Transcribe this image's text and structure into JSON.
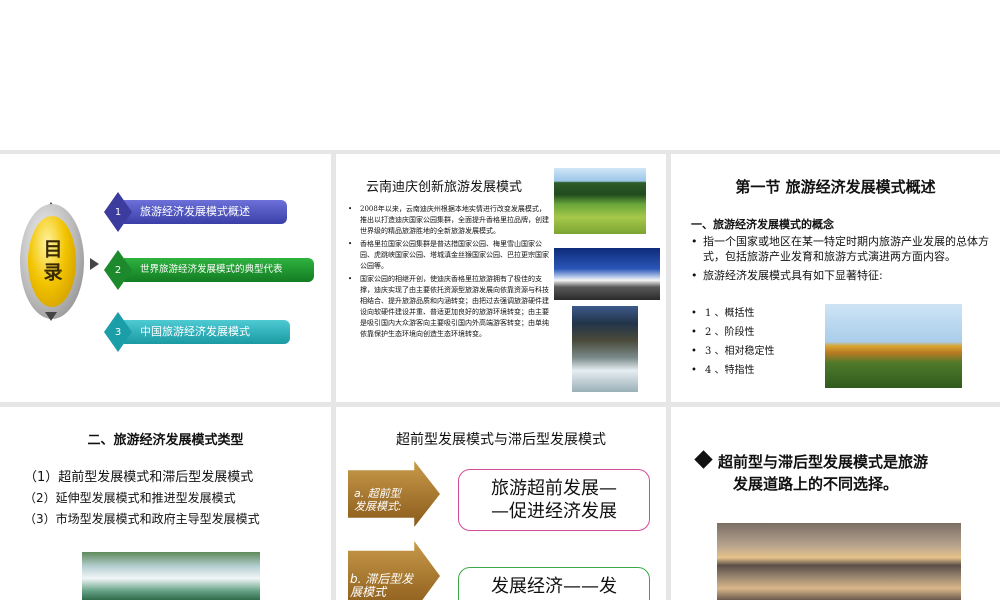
{
  "slide1": {
    "toc_title": "目录",
    "items": [
      {
        "num": "1",
        "label": "旅游经济发展模式概述"
      },
      {
        "num": "2",
        "label": "世界旅游经济发展模式的典型代表"
      },
      {
        "num": "3",
        "label": "中国旅游经济发展模式"
      }
    ]
  },
  "slide2": {
    "title": "云南迪庆创新旅游发展模式",
    "bullets": [
      "2008年以来，云南迪庆州根据本地实情进行改变发展模式，推出以打造迪庆国家公园集群，全面提升香格里拉品牌，创建世界级的精品旅游胜地的全新旅游发展模式。",
      "香格里拉国家公园集群是普达措国家公园、梅里雪山国家公园、虎跳峡国家公园、塔城滇金丝猴国家公园、巴拉更宗国家公园等。",
      "国家公园的相继开创，使迪庆香格里拉旅游拥有了极佳的支撑，迪庆实现了由主要依托资源型旅游发展向依靠资源与科技相结合、提升旅游品质和内涵转变；由把过去强调旅游硬件建设向软硬件建设并重、普适更加良好的旅游环境转变；由主要是吸引国内大众游客向主要吸引国内外高端游客转变；由单纯依靠保护生态环境向创造生态环境转变。"
    ]
  },
  "slide3": {
    "title": "第一节  旅游经济发展模式概述",
    "subtitle": "一、旅游经济发展模式的概念",
    "para1": "指一个国家或地区在某一特定时期内旅游产业发展的总体方式，包括旅游产业发育和旅游方式演进两方面内容。",
    "para2": "旅游经济发展模式具有如下显著特征:",
    "features": [
      "1 、概括性",
      "2 、阶段性",
      "3 、相对稳定性",
      "4 、特指性"
    ]
  },
  "slide4": {
    "title": "二、旅游经济发展模式类型",
    "items": [
      "（1）超前型发展模式和滞后型发展模式",
      "（2）延伸型发展模式和推进型发展模式",
      "（3）市场型发展模式和政府主导型发展模式"
    ]
  },
  "slide5": {
    "title": "超前型发展模式与滞后型发展模式",
    "arrow_a_line1": "a. 超前型",
    "arrow_a_line2": "发展模式:",
    "arrow_b_line1": "b. 滞后型发",
    "arrow_b_line2": "展模式",
    "box_a_line1": "旅游超前发展—",
    "box_a_line2": "—促进经济发展",
    "box_b_line1": "发展经济——发"
  },
  "slide6": {
    "line1": "超前型与滞后型发展模式是旅游",
    "line2": "发展道路上的不同选择。"
  },
  "colors": {
    "band": "#e6e6e6",
    "toc_blue": "#3a3fa8",
    "toc_green": "#137c22",
    "toc_teal": "#1b9aa4",
    "arrow_brown": "#8a5a1a",
    "box_pink": "#d44a9a",
    "box_green": "#3aa84a"
  }
}
